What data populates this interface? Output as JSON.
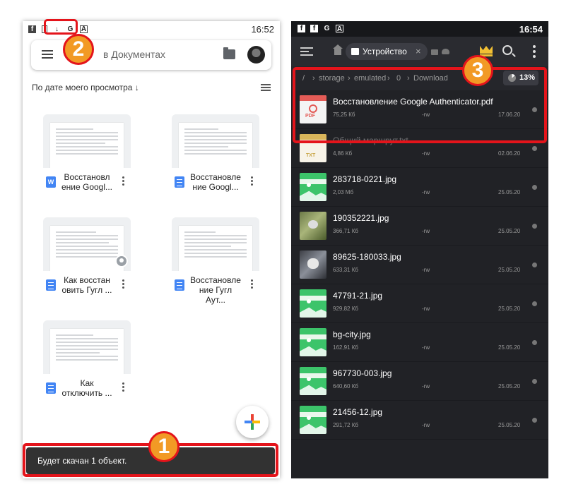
{
  "left_screen": {
    "status_bar": {
      "time": "16:52",
      "icons": [
        "facebook-icon",
        "sim-icon",
        "download-icon",
        "google-icon",
        "adblock-icon"
      ]
    },
    "search": {
      "placeholder": "Поиск в Документах",
      "visible_text": "в Документах"
    },
    "sort": {
      "label": "По дате моего просмотра",
      "arrow": "↓"
    },
    "documents": [
      {
        "title": "Восстановление Googl...",
        "line1": "Восстановл",
        "line2": "ение Googl...",
        "type": "word",
        "type_letter": "W"
      },
      {
        "title": "Восстановление Googl...",
        "line1": "Восстановле",
        "line2": "ние Googl...",
        "type": "gdoc",
        "type_letter": ""
      },
      {
        "title": "Как восстановить Гугл ...",
        "line1": "Как восстан",
        "line2": "овить Гугл ...",
        "type": "gdoc",
        "type_letter": "",
        "shared": true
      },
      {
        "title": "Восстановление Гугл Аут...",
        "line1": "Восстановле",
        "line2": "ние Гугл Аут...",
        "type": "gdoc",
        "type_letter": ""
      },
      {
        "title": "Как отключить ...",
        "line1": "Как",
        "line2": "отключить ...",
        "type": "gdoc",
        "type_letter": ""
      }
    ],
    "snackbar": "Будет скачан 1 объект."
  },
  "right_screen": {
    "status_bar": {
      "time": "16:54",
      "icons": [
        "facebook-icon",
        "facebook-icon",
        "google-icon",
        "adblock-icon"
      ]
    },
    "tab_label": "Устройство",
    "tab_close": "×",
    "path": [
      "/",
      "storage",
      "emulated",
      "0",
      "Download"
    ],
    "storage_percent": "13%",
    "files": [
      {
        "name": "Восстановление Google Authenticator.pdf",
        "size": "75,25 Кб",
        "perm": "-rw",
        "date": "17.06.20",
        "thumb": "pdf"
      },
      {
        "name": "Общий маршрут.txt",
        "size": "4,86 Кб",
        "perm": "-rw",
        "date": "02.06.20",
        "thumb": "txt"
      },
      {
        "name": "283718-0221.jpg",
        "size": "2,03 Мб",
        "perm": "-rw",
        "date": "25.05.20",
        "thumb": "img"
      },
      {
        "name": "190352221.jpg",
        "size": "366,71 Кб",
        "perm": "-rw",
        "date": "25.05.20",
        "thumb": "photo1"
      },
      {
        "name": "89625-180033.jpg",
        "size": "633,31 Кб",
        "perm": "-rw",
        "date": "25.05.20",
        "thumb": "photo2"
      },
      {
        "name": "47791-21.jpg",
        "size": "929,82 Кб",
        "perm": "-rw",
        "date": "25.05.20",
        "thumb": "img"
      },
      {
        "name": "bg-city.jpg",
        "size": "162,91 Кб",
        "perm": "-rw",
        "date": "25.05.20",
        "thumb": "img"
      },
      {
        "name": "967730-003.jpg",
        "size": "640,60 Кб",
        "perm": "-rw",
        "date": "25.05.20",
        "thumb": "img"
      },
      {
        "name": "21456-12.jpg",
        "size": "291,72 Кб",
        "perm": "-rw",
        "date": "25.05.20",
        "thumb": "img"
      }
    ]
  },
  "annotations": {
    "marker_1": "1",
    "marker_2": "2",
    "marker_3": "3",
    "highlight_color": "#e4141b",
    "marker_color": "#f29a25"
  }
}
